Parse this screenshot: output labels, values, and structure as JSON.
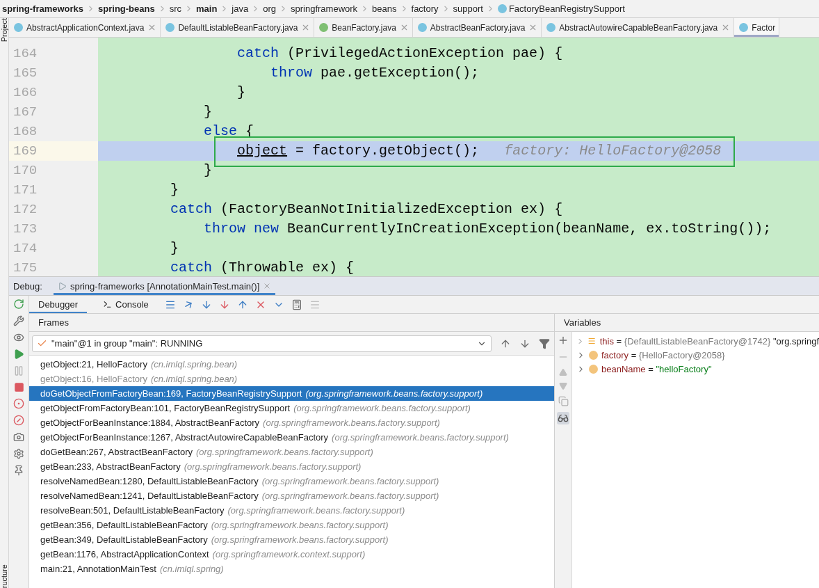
{
  "breadcrumbs": [
    {
      "label": "spring-frameworks",
      "kind": "module"
    },
    {
      "label": "spring-beans",
      "kind": "module"
    },
    {
      "label": "src",
      "kind": "folder"
    },
    {
      "label": "main",
      "kind": "module"
    },
    {
      "label": "java",
      "kind": "folder"
    },
    {
      "label": "org",
      "kind": "folder"
    },
    {
      "label": "springframework",
      "kind": "folder"
    },
    {
      "label": "beans",
      "kind": "folder"
    },
    {
      "label": "factory",
      "kind": "folder"
    },
    {
      "label": "support",
      "kind": "folder"
    },
    {
      "label": "FactoryBeanRegistrySupport",
      "kind": "class"
    }
  ],
  "side_labels": {
    "top": "Project",
    "bottom": "ructure"
  },
  "editor_tabs": [
    {
      "label": "AbstractApplicationContext.java",
      "kind": "class",
      "selected": false
    },
    {
      "label": "DefaultListableBeanFactory.java",
      "kind": "class",
      "selected": false
    },
    {
      "label": "BeanFactory.java",
      "kind": "interface",
      "selected": false
    },
    {
      "label": "AbstractBeanFactory.java",
      "kind": "class",
      "selected": false
    },
    {
      "label": "AbstractAutowireCapableBeanFactory.java",
      "kind": "class",
      "selected": false
    },
    {
      "label": "Factor",
      "kind": "class",
      "selected": true
    }
  ],
  "code_lines": [
    {
      "number": "164",
      "selected": false,
      "tokens": [
        {
          "kind": "keyword",
          "text": "                catch"
        },
        {
          "kind": "plain",
          "text": " (PrivilegedActionException pae) {"
        }
      ]
    },
    {
      "number": "165",
      "selected": false,
      "tokens": [
        {
          "kind": "keyword",
          "text": "                    throw"
        },
        {
          "kind": "plain",
          "text": " pae.getException();"
        }
      ]
    },
    {
      "number": "166",
      "selected": false,
      "tokens": [
        {
          "kind": "plain",
          "text": "                }"
        }
      ]
    },
    {
      "number": "167",
      "selected": false,
      "tokens": [
        {
          "kind": "plain",
          "text": "            }"
        }
      ]
    },
    {
      "number": "168",
      "selected": false,
      "tokens": [
        {
          "kind": "keyword",
          "text": "            else"
        },
        {
          "kind": "plain",
          "text": " {"
        }
      ]
    },
    {
      "number": "169",
      "selected": true,
      "tokens": [
        {
          "kind": "underlined",
          "text": "                object"
        },
        {
          "kind": "plain",
          "text": " = factory.getObject();"
        },
        {
          "kind": "hint",
          "text": "   factory: HelloFactory@2058"
        }
      ]
    },
    {
      "number": "170",
      "selected": false,
      "tokens": [
        {
          "kind": "plain",
          "text": "            }"
        }
      ]
    },
    {
      "number": "171",
      "selected": false,
      "tokens": [
        {
          "kind": "plain",
          "text": "        }"
        }
      ]
    },
    {
      "number": "172",
      "selected": false,
      "tokens": [
        {
          "kind": "keyword",
          "text": "        catch"
        },
        {
          "kind": "plain",
          "text": " (FactoryBeanNotInitializedException ex) {"
        }
      ]
    },
    {
      "number": "173",
      "selected": false,
      "tokens": [
        {
          "kind": "keyword",
          "text": "            throw new"
        },
        {
          "kind": "plain",
          "text": " BeanCurrentlyInCreationException(beanName, ex.toString());"
        }
      ]
    },
    {
      "number": "174",
      "selected": false,
      "tokens": [
        {
          "kind": "plain",
          "text": "        }"
        }
      ]
    },
    {
      "number": "175",
      "selected": false,
      "tokens": [
        {
          "kind": "keyword",
          "text": "        catch"
        },
        {
          "kind": "plain",
          "text": " (Throwable ex) {"
        }
      ]
    }
  ],
  "debug": {
    "label": "Debug:",
    "session": "spring-frameworks [AnnotationMainTest.main()]",
    "tabs": [
      {
        "label": "Debugger",
        "selected": true
      },
      {
        "label": "Console",
        "selected": false
      }
    ]
  },
  "frames": {
    "title": "Frames",
    "thread": "\"main\"@1 in group \"main\": RUNNING",
    "rows": [
      {
        "method": "getObject:21, HelloFactory",
        "package": "(cn.imlql.spring.bean)",
        "selected": false,
        "disabled": false
      },
      {
        "method": "getObject:16, HelloFactory",
        "package": "(cn.imlql.spring.bean)",
        "selected": false,
        "disabled": true
      },
      {
        "method": "doGetObjectFromFactoryBean:169, FactoryBeanRegistrySupport",
        "package": "(org.springframework.beans.factory.support)",
        "selected": true,
        "disabled": false
      },
      {
        "method": "getObjectFromFactoryBean:101, FactoryBeanRegistrySupport",
        "package": "(org.springframework.beans.factory.support)",
        "selected": false,
        "disabled": false
      },
      {
        "method": "getObjectForBeanInstance:1884, AbstractBeanFactory",
        "package": "(org.springframework.beans.factory.support)",
        "selected": false,
        "disabled": false
      },
      {
        "method": "getObjectForBeanInstance:1267, AbstractAutowireCapableBeanFactory",
        "package": "(org.springframework.beans.factory.support)",
        "selected": false,
        "disabled": false
      },
      {
        "method": "doGetBean:267, AbstractBeanFactory",
        "package": "(org.springframework.beans.factory.support)",
        "selected": false,
        "disabled": false
      },
      {
        "method": "getBean:233, AbstractBeanFactory",
        "package": "(org.springframework.beans.factory.support)",
        "selected": false,
        "disabled": false
      },
      {
        "method": "resolveNamedBean:1280, DefaultListableBeanFactory",
        "package": "(org.springframework.beans.factory.support)",
        "selected": false,
        "disabled": false
      },
      {
        "method": "resolveNamedBean:1241, DefaultListableBeanFactory",
        "package": "(org.springframework.beans.factory.support)",
        "selected": false,
        "disabled": false
      },
      {
        "method": "resolveBean:501, DefaultListableBeanFactory",
        "package": "(org.springframework.beans.factory.support)",
        "selected": false,
        "disabled": false
      },
      {
        "method": "getBean:356, DefaultListableBeanFactory",
        "package": "(org.springframework.beans.factory.support)",
        "selected": false,
        "disabled": false
      },
      {
        "method": "getBean:349, DefaultListableBeanFactory",
        "package": "(org.springframework.beans.factory.support)",
        "selected": false,
        "disabled": false
      },
      {
        "method": "getBean:1176, AbstractApplicationContext",
        "package": "(org.springframework.context.support)",
        "selected": false,
        "disabled": false
      },
      {
        "method": "main:21, AnnotationMainTest",
        "package": "(cn.imlql.spring)",
        "selected": false,
        "disabled": false
      }
    ]
  },
  "variables": {
    "title": "Variables",
    "items": [
      {
        "kind": "field",
        "name": "this",
        "separator": "=",
        "value": "{DefaultListableBeanFactory@1742}",
        "color": "#7a7a7a",
        "to_string": "\"org.springf"
      },
      {
        "kind": "param",
        "name": "factory",
        "separator": "=",
        "value": "{HelloFactory@2058}",
        "color": "#7a7a7a"
      },
      {
        "kind": "param",
        "name": "beanName",
        "separator": "=",
        "value": "\"helloFactory\"",
        "color": "#067d17"
      }
    ]
  }
}
